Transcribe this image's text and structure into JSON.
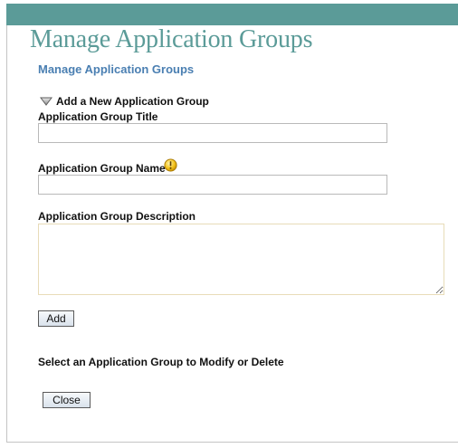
{
  "header": {
    "title": "Manage Application Groups",
    "subtitle": "Manage Application Groups",
    "bar_color": "#5b9b98",
    "title_color": "#5b9b98",
    "subtitle_color": "#4a7fb2"
  },
  "add_section": {
    "toggle_label": "Add a New Application Group",
    "toggle_icon": "triangle-down-icon",
    "title_label": "Application Group Title",
    "title_value": "",
    "name_label": "Application Group Name",
    "name_value": "",
    "name_info_icon": "info-icon",
    "description_label": "Application Group Description",
    "description_value": "",
    "add_button": "Add"
  },
  "modify_section": {
    "label": "Select an Application Group to Modify or Delete"
  },
  "footer": {
    "close_button": "Close"
  }
}
